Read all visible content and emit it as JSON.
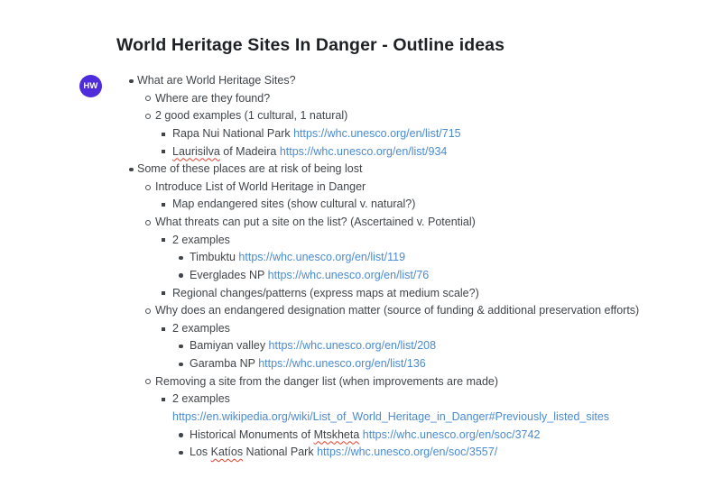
{
  "title": "World Heritage Sites In Danger - Outline ideas",
  "avatar": {
    "initials": "HW",
    "color": "#4e2bdb"
  },
  "colors": {
    "text": "#40454a",
    "title": "#1d2125",
    "link": "#4a8bd1",
    "spellcheck_underline": "#e8402a",
    "background": "#ffffff"
  },
  "outline": {
    "items": [
      {
        "level": 1,
        "bullet": "disc",
        "text": "What are World Heritage Sites?"
      },
      {
        "level": 2,
        "bullet": "circle",
        "text": "Where are they found?"
      },
      {
        "level": 2,
        "bullet": "circle",
        "text": "2 good examples (1 cultural, 1 natural)"
      },
      {
        "level": 3,
        "bullet": "square",
        "text": "Rapa Nui National Park ",
        "link": "https://whc.unesco.org/en/list/715"
      },
      {
        "level": 3,
        "bullet": "square",
        "mis": "Laurisilva",
        "post": " of Madeira ",
        "link": "https://whc.unesco.org/en/list/934"
      },
      {
        "level": 1,
        "bullet": "disc",
        "text": "Some of these places are at risk of being lost"
      },
      {
        "level": 2,
        "bullet": "circle",
        "text": "Introduce List of World Heritage in Danger"
      },
      {
        "level": 3,
        "bullet": "square",
        "text": "Map endangered sites (show cultural v. natural?)"
      },
      {
        "level": 2,
        "bullet": "circle",
        "text": "What threats can put a site on the list? (Ascertained v. Potential)"
      },
      {
        "level": 3,
        "bullet": "square",
        "text": "2 examples"
      },
      {
        "level": 4,
        "bullet": "disc",
        "text": "Timbuktu ",
        "link": "https://whc.unesco.org/en/list/119"
      },
      {
        "level": 4,
        "bullet": "disc",
        "text": "Everglades NP ",
        "link": "https://whc.unesco.org/en/list/76"
      },
      {
        "level": 3,
        "bullet": "square",
        "text": "Regional changes/patterns (express maps at medium scale?)"
      },
      {
        "level": 2,
        "bullet": "circle",
        "text": "Why does an endangered designation matter (source of funding & additional preservation efforts)"
      },
      {
        "level": 3,
        "bullet": "square",
        "text": "2 examples"
      },
      {
        "level": 4,
        "bullet": "disc",
        "text": "Bamiyan valley ",
        "link": "https://whc.unesco.org/en/list/208"
      },
      {
        "level": 4,
        "bullet": "disc",
        "text": "Garamba NP ",
        "link": "https://whc.unesco.org/en/list/136"
      },
      {
        "level": 2,
        "bullet": "circle",
        "text": "Removing a site from the danger list (when improvements are made)"
      },
      {
        "level": 3,
        "bullet": "square",
        "text": "2 examples"
      },
      {
        "level": 3,
        "bullet": "none",
        "link": "https://en.wikipedia.org/wiki/List_of_World_Heritage_in_Danger#Previously_listed_sites"
      },
      {
        "level": 4,
        "bullet": "disc",
        "pre": "Historical Monuments of ",
        "mis": "Mtskheta",
        "post": " ",
        "link": "https://whc.unesco.org/en/soc/3742"
      },
      {
        "level": 4,
        "bullet": "disc",
        "pre": "Los ",
        "mis": "Katíos",
        "post": " National Park ",
        "link": "https://whc.unesco.org/en/soc/3557/"
      }
    ]
  }
}
